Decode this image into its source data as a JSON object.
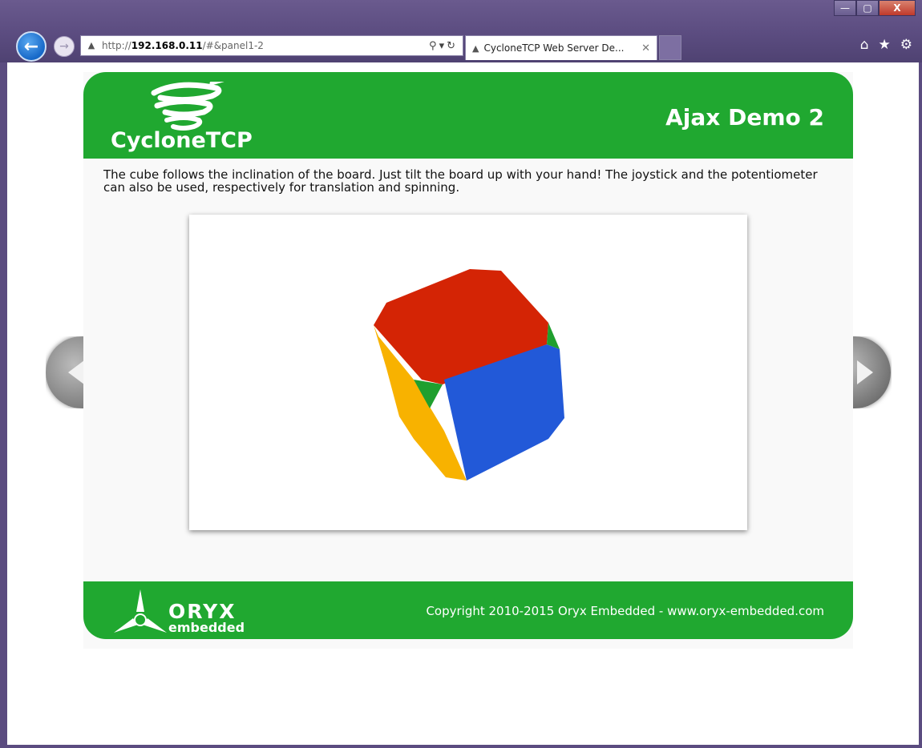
{
  "browser": {
    "address": {
      "url_prefix": "http://",
      "url_host": "192.168.0.11",
      "url_path": "/#&panel1-2"
    },
    "tab": {
      "title": "CycloneTCP Web Server De...",
      "close": "✕"
    },
    "window_controls": {
      "minimize": "—",
      "maximize": "▢",
      "close": "X"
    },
    "icons": [
      "back-arrow-icon",
      "forward-arrow-icon",
      "search-icon",
      "refresh-icon",
      "home-icon",
      "favorites-star-icon",
      "settings-gear-icon"
    ]
  },
  "header": {
    "brand": "CycloneTCP",
    "title": "Ajax Demo 2"
  },
  "content": {
    "description": "The cube follows the inclination of the board. Just tilt the board up with your hand! The joystick and the potentiometer can also be used, respectively for translation and spinning.",
    "cube_colors": {
      "top": "#d42405",
      "front": "#2259d8",
      "left": "#f8b200",
      "corner": "#1f9f2e"
    }
  },
  "footer": {
    "logo_word": "ORYX",
    "logo_sub": "embedded",
    "copyright": "Copyright 2010-2015 Oryx Embedded - www.oryx-embedded.com"
  },
  "colors": {
    "brand_green": "#20a830",
    "chrome": "#5b4c80"
  }
}
